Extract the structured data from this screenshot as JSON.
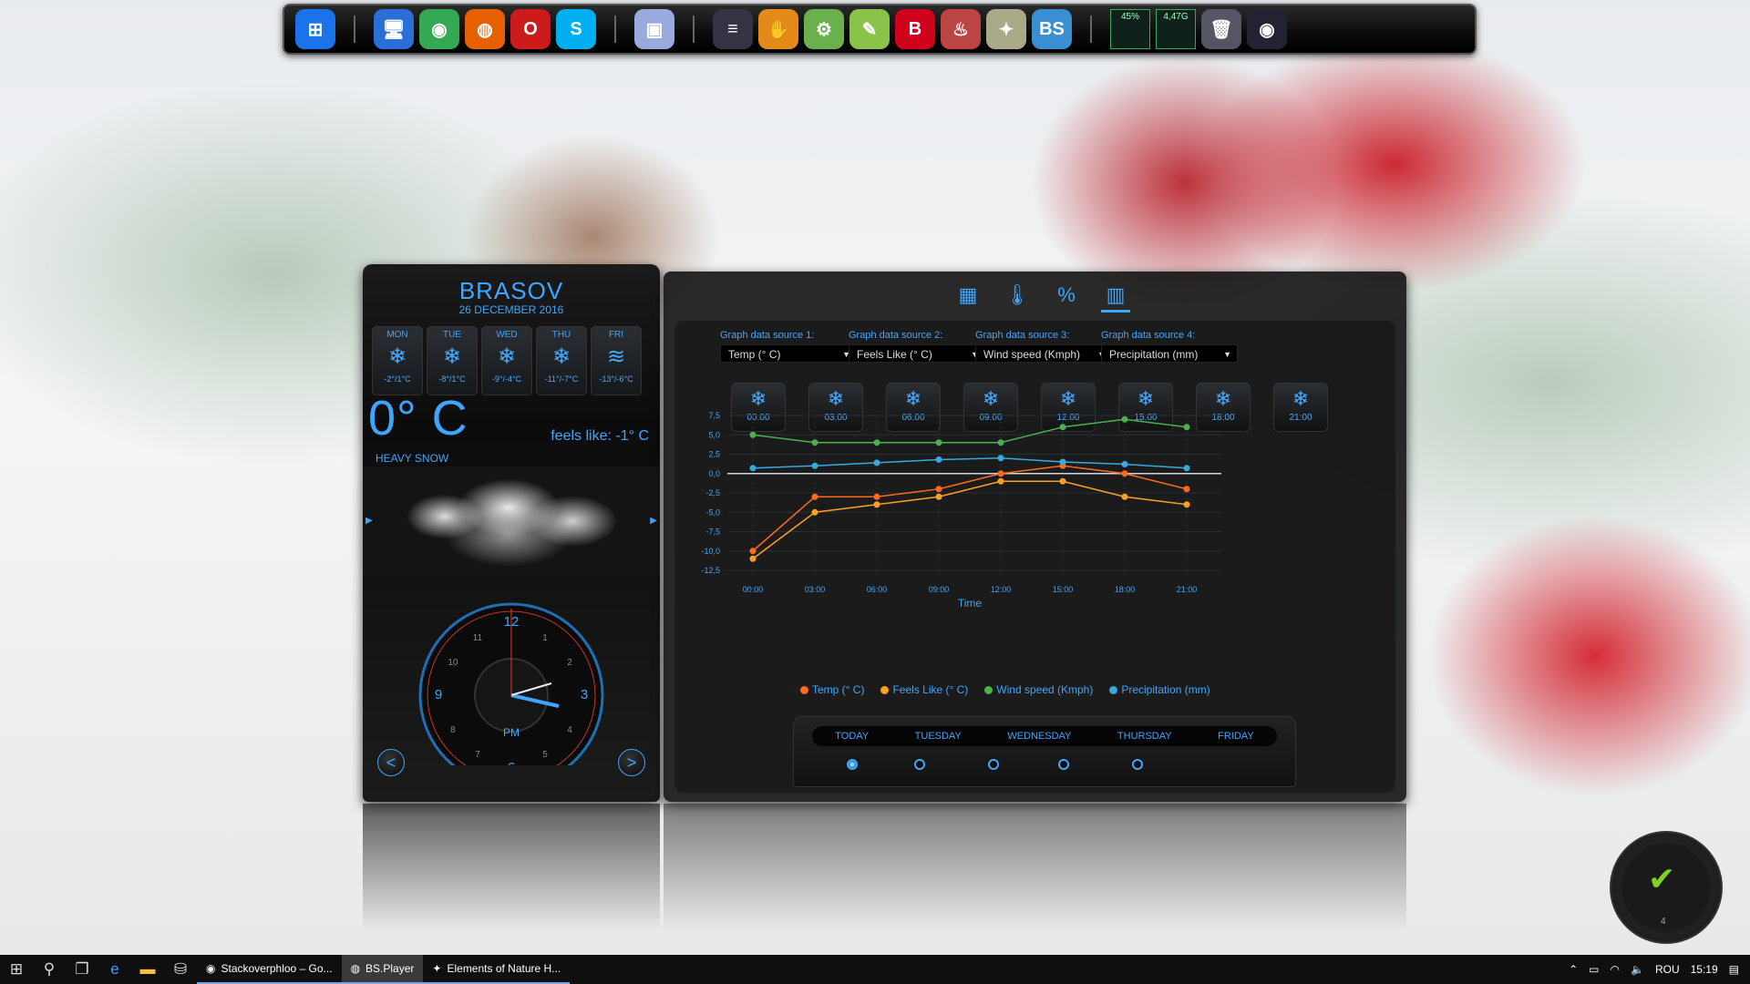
{
  "dock": {
    "items": [
      {
        "name": "windows-logo-icon",
        "glyph": "⊞",
        "color": "#1a73e8"
      },
      {
        "sep": true
      },
      {
        "name": "computer-icon",
        "glyph": "🖥",
        "color": "#2a6fd6"
      },
      {
        "name": "chrome-icon",
        "glyph": "◉",
        "color": "#34a853"
      },
      {
        "name": "firefox-icon",
        "glyph": "◍",
        "color": "#e66000"
      },
      {
        "name": "opera-icon",
        "glyph": "O",
        "color": "#cc1b1b"
      },
      {
        "name": "skype-icon",
        "glyph": "S",
        "color": "#00aff0"
      },
      {
        "sep": true
      },
      {
        "name": "cube-icon",
        "glyph": "▣",
        "color": "#9ad"
      },
      {
        "sep": true
      },
      {
        "name": "winamp-icon",
        "glyph": "≡",
        "color": "#334"
      },
      {
        "name": "hand-icon",
        "glyph": "✋",
        "color": "#e48a18"
      },
      {
        "name": "android-icon",
        "glyph": "⚙",
        "color": "#6ab04c"
      },
      {
        "name": "notepad-icon",
        "glyph": "✎",
        "color": "#8bc34a"
      },
      {
        "name": "bitdefender-icon",
        "glyph": "B",
        "color": "#d0021b"
      },
      {
        "name": "flame-icon",
        "glyph": "♨",
        "color": "#b44"
      },
      {
        "name": "bulb-icon",
        "glyph": "✦",
        "color": "#aa8"
      },
      {
        "name": "bsplayer-icon",
        "glyph": "BS",
        "color": "#3a8fd0"
      },
      {
        "sep": true
      }
    ],
    "cpu_meter": "45%",
    "ram_meter": "4,47G"
  },
  "left_widget": {
    "city": "BRASOV",
    "date": "26 DECEMBER 2016",
    "days": [
      {
        "name": "MON",
        "temps": "-2°/1°C",
        "glyph": "❄"
      },
      {
        "name": "TUE",
        "temps": "-8°/1°C",
        "glyph": "❄"
      },
      {
        "name": "WED",
        "temps": "-9°/-4°C",
        "glyph": "❄"
      },
      {
        "name": "THU",
        "temps": "-11°/-7°C",
        "glyph": "❄"
      },
      {
        "name": "FRI",
        "temps": "-13°/-6°C",
        "glyph": "≋"
      }
    ],
    "temperature": "0° C",
    "feels_like": "feels like: -1° C",
    "condition": "HEAVY SNOW",
    "clock_ampm": "PM",
    "clock_numbers": [
      "12",
      "1",
      "2",
      "3",
      "4",
      "5",
      "6",
      "7",
      "8",
      "9",
      "10",
      "11"
    ],
    "prev_label": "<",
    "next_label": ">"
  },
  "right_widget": {
    "tabs": [
      {
        "name": "calendar-tab-icon",
        "glyph": "▦"
      },
      {
        "name": "thermometer-tab-icon",
        "glyph": "🌡"
      },
      {
        "name": "percent-tab-icon",
        "glyph": "%"
      },
      {
        "name": "bar-graph-tab-icon",
        "glyph": "▥",
        "active": true
      }
    ],
    "sources": [
      {
        "label": "Graph data source 1:",
        "value": "Temp (° C)"
      },
      {
        "label": "Graph data source 2:",
        "value": "Feels Like (° C)"
      },
      {
        "label": "Graph data source 3:",
        "value": "Wind speed (Kmph)"
      },
      {
        "label": "Graph data source 4:",
        "value": "Precipitation (mm)"
      }
    ],
    "hours": [
      "00:00",
      "03:00",
      "06:00",
      "09:00",
      "12:00",
      "15:00",
      "18:00",
      "21:00"
    ],
    "day_tabs": [
      "TODAY",
      "TUESDAY",
      "WEDNESDAY",
      "THURSDAY",
      "FRIDAY"
    ],
    "selected_day": 0
  },
  "chart_data": {
    "type": "line",
    "x": [
      "00:00",
      "03:00",
      "06:00",
      "09:00",
      "12:00",
      "15:00",
      "18:00",
      "21:00"
    ],
    "xlabel": "Time",
    "ylabel": "",
    "ylim": [
      -12.5,
      7.5
    ],
    "yticks": [
      "7,5",
      "5,0",
      "2,5",
      "0,0",
      "-2,5",
      "-5,0",
      "-7,5",
      "-10,0",
      "-12,5"
    ],
    "ytick_values": [
      7.5,
      5,
      2.5,
      0,
      -2.5,
      -5,
      -7.5,
      -10,
      -12.5
    ],
    "series": [
      {
        "name": "Temp (° C)",
        "color": "#ff6a1a",
        "values": [
          -10,
          -3,
          -3,
          -2,
          0,
          1,
          0,
          -2
        ]
      },
      {
        "name": "Feels Like (° C)",
        "color": "#ffa020",
        "values": [
          -11,
          -5,
          -4,
          -3,
          -1,
          -1,
          -3,
          -4
        ]
      },
      {
        "name": "Wind speed (Kmph)",
        "color": "#4caf50",
        "values": [
          5,
          4,
          4,
          4,
          4,
          6,
          7,
          6
        ]
      },
      {
        "name": "Precipitation (mm)",
        "color": "#35a9e0",
        "values": [
          0.7,
          1,
          1.4,
          1.8,
          2,
          1.5,
          1.2,
          0.7
        ]
      }
    ],
    "grid": true,
    "legend": "bottom"
  },
  "taskbar": {
    "apps": [
      {
        "name": "task-chrome",
        "label": "Stackoverphloo – Go...",
        "glyph": "◉",
        "hl": false
      },
      {
        "name": "task-bsplayer",
        "label": "BS.Player",
        "glyph": "◍",
        "hl": true
      },
      {
        "name": "task-elements",
        "label": "Elements of Nature H...",
        "glyph": "✦",
        "hl": false
      }
    ],
    "language": "ROU",
    "time": "15:19"
  },
  "gauge_number": "4"
}
